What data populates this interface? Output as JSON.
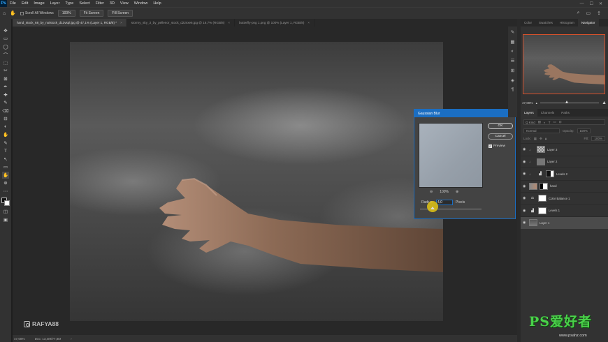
{
  "app": {
    "logo": "Ps"
  },
  "menu": [
    "File",
    "Edit",
    "Image",
    "Layer",
    "Type",
    "Select",
    "Filter",
    "3D",
    "View",
    "Window",
    "Help"
  ],
  "menubar_right": [
    "—",
    "☐",
    "✕"
  ],
  "options": {
    "scroll_all_windows": "Scroll All Windows",
    "zoom": "100%",
    "fit_screen": "Fit Screen",
    "fill_screen": "Fill Screen",
    "right_icons": [
      "search-icon",
      "workspace-icon",
      "share-icon"
    ]
  },
  "tabs": [
    {
      "label": "hand_stock_68_by_noistock_d13vspl.jpg @ 47,1% (Layer 1, RGB/8) *",
      "close": "×"
    },
    {
      "label": "stormy_sky_3_by_pellenor_stock_d22sxe6.jpg @ 16,7% (RGB/8)",
      "close": "×"
    },
    {
      "label": "butterfly-png 1.png @ 100% (Layer 1, RGB/8)",
      "close": "×"
    }
  ],
  "tools": [
    "✥",
    "▭",
    "◯",
    "⌒",
    "⬚",
    "✂",
    "⊠",
    "✒",
    "✚",
    "✎",
    "⌫",
    "⊟",
    "◐",
    "✋",
    "✎",
    "T",
    "↖",
    "▭",
    "✋",
    "⊕",
    "⋯"
  ],
  "watermark": {
    "handle": "RAFYA88"
  },
  "status": {
    "zoom": "47,08%",
    "doc": "Doc: 13,4M/77,8M",
    "arrow": "›"
  },
  "dialog": {
    "title": "Gaussian Blur",
    "close": "✕",
    "ok": "OK",
    "cancel": "Cancel",
    "preview_label": "Preview",
    "preview_checked": "✓",
    "zoom_out": "⊖",
    "zoom_value": "100%",
    "zoom_in": "⊕",
    "radius_label": "Radius:",
    "radius_value": "4,0",
    "radius_unit": "Pixels",
    "radius_slider_fraction": 0.2
  },
  "navigator": {
    "tabs": [
      "Color",
      "Swatches",
      "Histogram",
      "Navigator"
    ],
    "zoom": "47,08%",
    "zoom_slider_fraction": 0.45
  },
  "layers_panel": {
    "tabs": [
      "Layers",
      "Channels",
      "Paths"
    ],
    "filter_label": "Q Kind",
    "blend_mode": "Normal",
    "opacity_label": "Opacity:",
    "opacity_value": "100%",
    "lock_label": "Lock:",
    "fill_label": "Fill:",
    "fill_value": "100%",
    "layers": [
      {
        "name": "Layer 3",
        "type": "pixel",
        "visible": true,
        "selected": false
      },
      {
        "name": "Layer 2",
        "type": "pixel",
        "visible": true,
        "selected": false
      },
      {
        "name": "Levels 2",
        "type": "adjustment",
        "visible": true,
        "selected": false
      },
      {
        "name": "hand",
        "type": "pixel-mask",
        "visible": true,
        "selected": false
      },
      {
        "name": "Color Balance 1",
        "type": "adjustment",
        "visible": true,
        "selected": false
      },
      {
        "name": "Levels 1",
        "type": "adjustment",
        "visible": true,
        "selected": false
      },
      {
        "name": "Layer 1",
        "type": "pixel",
        "visible": true,
        "selected": true
      }
    ]
  },
  "site_watermark": {
    "logo": "PS爱好者",
    "url": "www.psahz.com"
  },
  "colors": {
    "accent_blue": "#1b6ec2",
    "cursor_yellow": "#e2c414",
    "nav_frame": "#d6512c",
    "watermark_green": "#4ad04a"
  }
}
